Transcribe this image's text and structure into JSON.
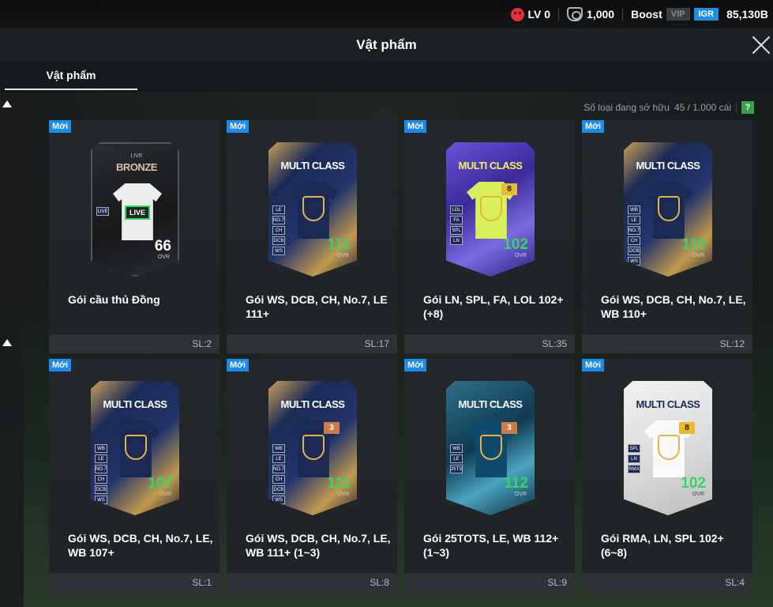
{
  "topbar": {
    "level": "LV 0",
    "coins": "1,000",
    "boost": "Boost",
    "vip": "VIP",
    "igr": "IGR",
    "balance": "85,130B"
  },
  "header": {
    "title": "Vật phẩm"
  },
  "tabs": [
    {
      "label": "Vật phẩm"
    }
  ],
  "owned": {
    "label": "Số loại đang sở hữu",
    "count": "45 / 1.000 cái",
    "help": "?"
  },
  "items": [
    {
      "badge": "Mới",
      "name": "Gói cầu thủ Đồng",
      "qty": "SL:2",
      "pack": {
        "style": "bronze",
        "top_label": "LIVE",
        "title": "BRONZE",
        "shirt_text": "LIVE",
        "ovr": "66",
        "ovr_label": "OVR",
        "tags": [
          "LIVE"
        ],
        "level": ""
      }
    },
    {
      "badge": "Mới",
      "name": "Gói WS, DCB, CH, No.7, LE 111+",
      "qty": "SL:17",
      "pack": {
        "style": "gold",
        "title": "MULTI CLASS",
        "ovr": "111",
        "ovr_label": "OVR",
        "tags": [
          "LE",
          "NO.7",
          "CH",
          "DCB",
          "WS"
        ],
        "level": ""
      }
    },
    {
      "badge": "Mới",
      "name": "Gói LN, SPL, FA, LOL 102+ (+8)",
      "qty": "SL:35",
      "pack": {
        "style": "purple",
        "title": "MULTI CLASS",
        "ovr": "102",
        "ovr_label": "OVR",
        "tags": [
          "LOL",
          "FA",
          "SPL",
          "LN"
        ],
        "level": "8"
      }
    },
    {
      "badge": "Mới",
      "name": "Gói WS, DCB, CH, No.7, LE, WB 110+",
      "qty": "SL:12",
      "pack": {
        "style": "gold",
        "title": "MULTI CLASS",
        "ovr": "110",
        "ovr_label": "OVR",
        "tags": [
          "WB",
          "LE",
          "NO.7",
          "CH",
          "DCB",
          "WS"
        ],
        "level": ""
      }
    },
    {
      "badge": "Mới",
      "name": "Gói WS, DCB, CH, No.7, LE, WB 107+",
      "qty": "SL:1",
      "pack": {
        "style": "gold",
        "title": "MULTI CLASS",
        "ovr": "107",
        "ovr_label": "OVR",
        "tags": [
          "WB",
          "LE",
          "NO.7",
          "CH",
          "DCB",
          "WS"
        ],
        "level": ""
      }
    },
    {
      "badge": "Mới",
      "name": "Gói WS, DCB, CH, No.7, LE, WB 111+ (1~3)",
      "qty": "SL:8",
      "pack": {
        "style": "gold",
        "title": "MULTI CLASS",
        "ovr": "111",
        "ovr_label": "OVR",
        "tags": [
          "WB",
          "LE",
          "NO.7",
          "CH",
          "DCB",
          "WS"
        ],
        "level": "3"
      }
    },
    {
      "badge": "Mới",
      "name": "Gói 25TOTS, LE, WB 112+ (1~3)",
      "qty": "SL:9",
      "pack": {
        "style": "teal",
        "title": "MULTI CLASS",
        "ovr": "112",
        "ovr_label": "OVR",
        "tags": [
          "WB",
          "LE",
          "25TS"
        ],
        "level": "3"
      }
    },
    {
      "badge": "Mới",
      "name": "Gói RMA, LN, SPL 102+ (6~8)",
      "qty": "SL:4",
      "pack": {
        "style": "white",
        "title": "MULTI CLASS",
        "ovr": "102",
        "ovr_label": "OVR",
        "tags": [
          "SPL",
          "LN",
          "RMA"
        ],
        "level": "8"
      }
    }
  ]
}
